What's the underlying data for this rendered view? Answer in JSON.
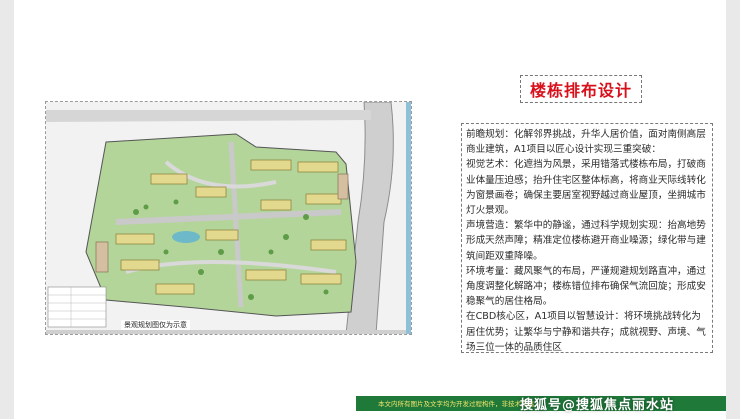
{
  "title": "楼栋排布设计",
  "paragraphs": [
    "前瞻规划：化解邻界挑战，升华人居价值，面对南侧高层商业建筑，A1项目以匠心设计实现三重突破：",
    "视觉艺术：化遮挡为风景，采用错落式楼栋布局，打破商业体量压迫感；抬升住宅区整体标高，将商业天际线转化为窗景画卷；确保主要居室视野越过商业屋顶，坐拥城市灯火景观。",
    "声境营造：繁华中的静谧，通过科学规划实现：抬高地势形成天然声障；精准定位楼栋避开商业噪源；绿化带与建筑间距双重降噪。",
    "环境考量：藏风聚气的布局，严谨规避规划路直冲，通过角度调整化解路冲；楼栋错位排布确保气流回旋；形成安稳聚气的居住格局。",
    "在CBD核心区，A1项目以智慧设计：将环境挑战转化为居住优势；让繁华与宁静和谐共存；成就视野、声境、气场三位一体的品质住区"
  ],
  "map": {
    "caption": "景观规划图仅为示意",
    "colors": {
      "road": "#cfcfcf",
      "green": "#9fc68a",
      "building": "#e2d98e",
      "water": "#6db9c9"
    }
  },
  "footer": {
    "notice": "本文内所有图片及文字均为开发过程构件，非技术终稿",
    "watermark": "搜狐号@搜狐焦点丽水站"
  }
}
